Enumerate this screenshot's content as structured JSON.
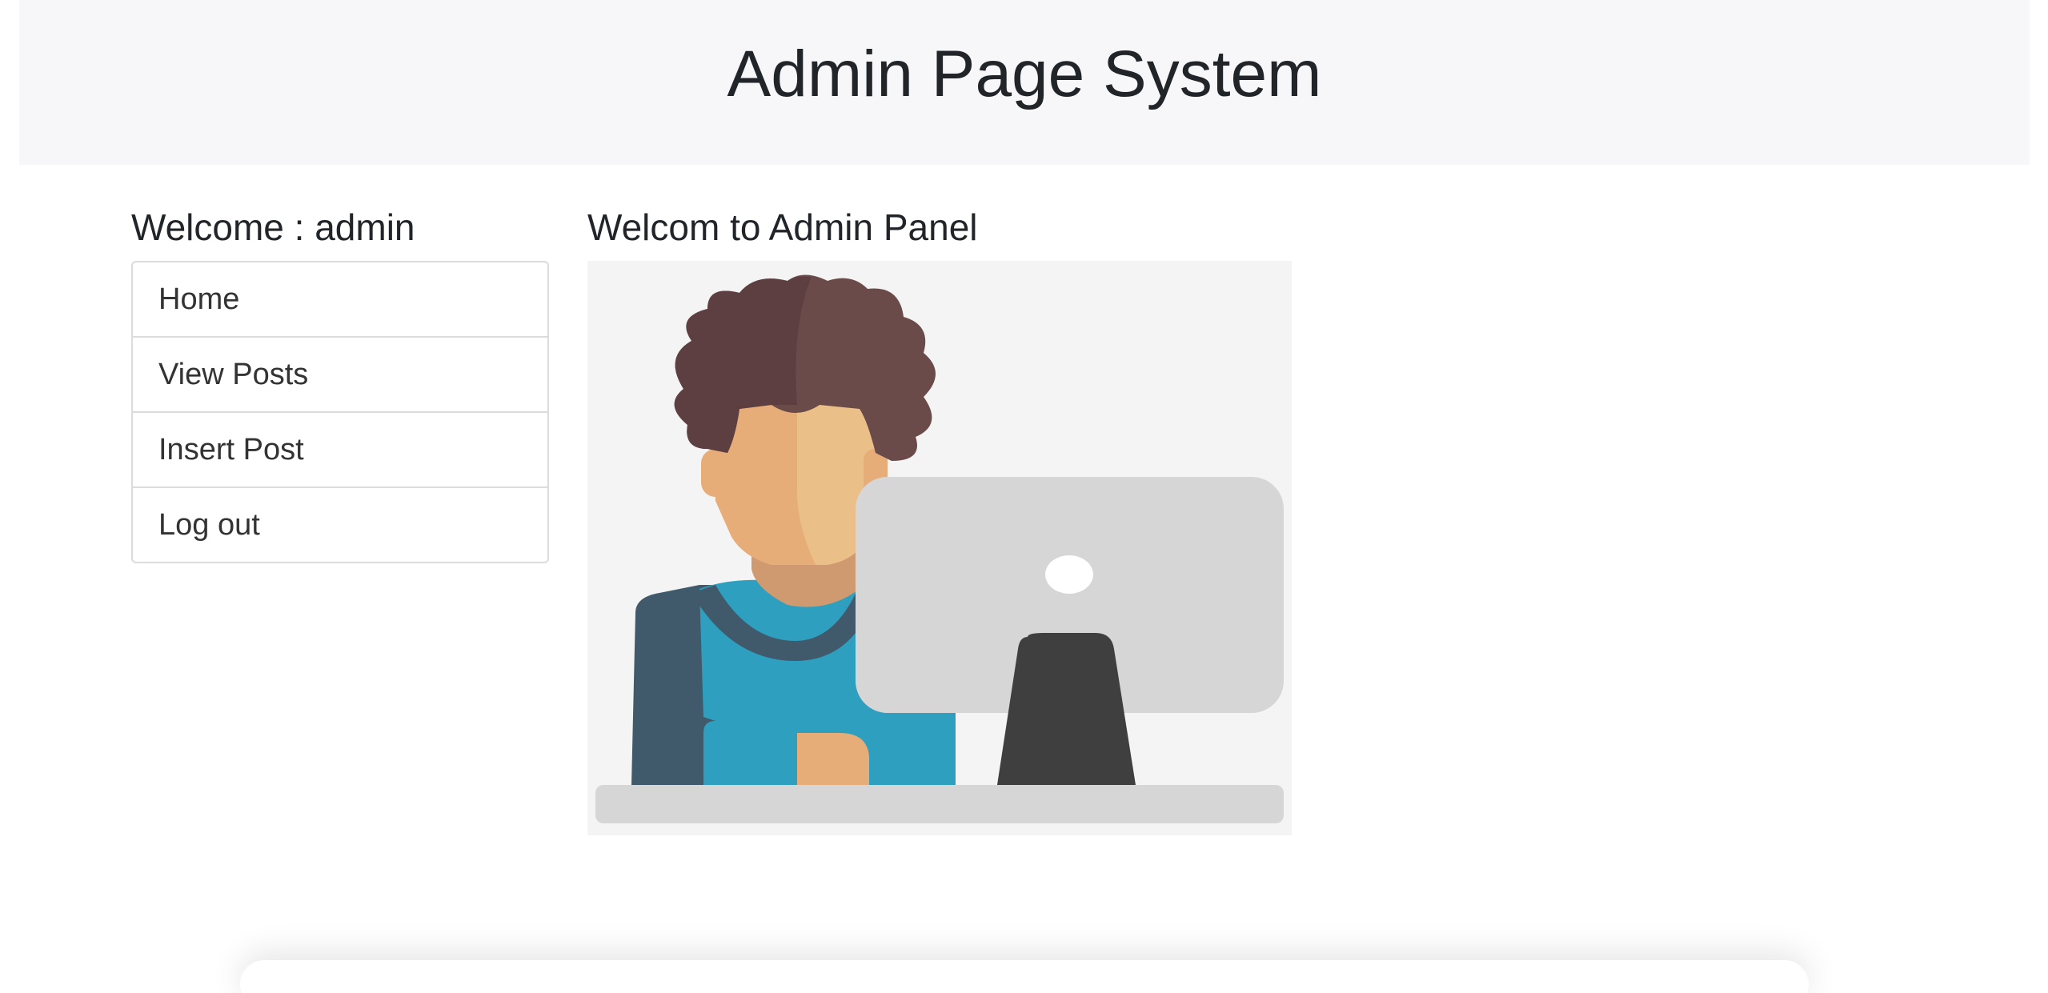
{
  "header": {
    "title": "Admin Page System"
  },
  "sidebar": {
    "welcome": "Welcome : admin",
    "items": [
      {
        "label": "Home"
      },
      {
        "label": "View Posts"
      },
      {
        "label": "Insert Post"
      },
      {
        "label": "Log out"
      }
    ]
  },
  "main": {
    "heading": "Welcom to Admin Panel",
    "image_icon": "person-at-computer-illustration"
  },
  "colors": {
    "header_bg": "#f7f7f9",
    "hair": "#6b4a4a",
    "skin": "#e8b07a",
    "shirt": "#2f9fbf",
    "sleeve": "#415a6b",
    "monitor": "#d6d6d6",
    "stand": "#3f3f3f"
  }
}
